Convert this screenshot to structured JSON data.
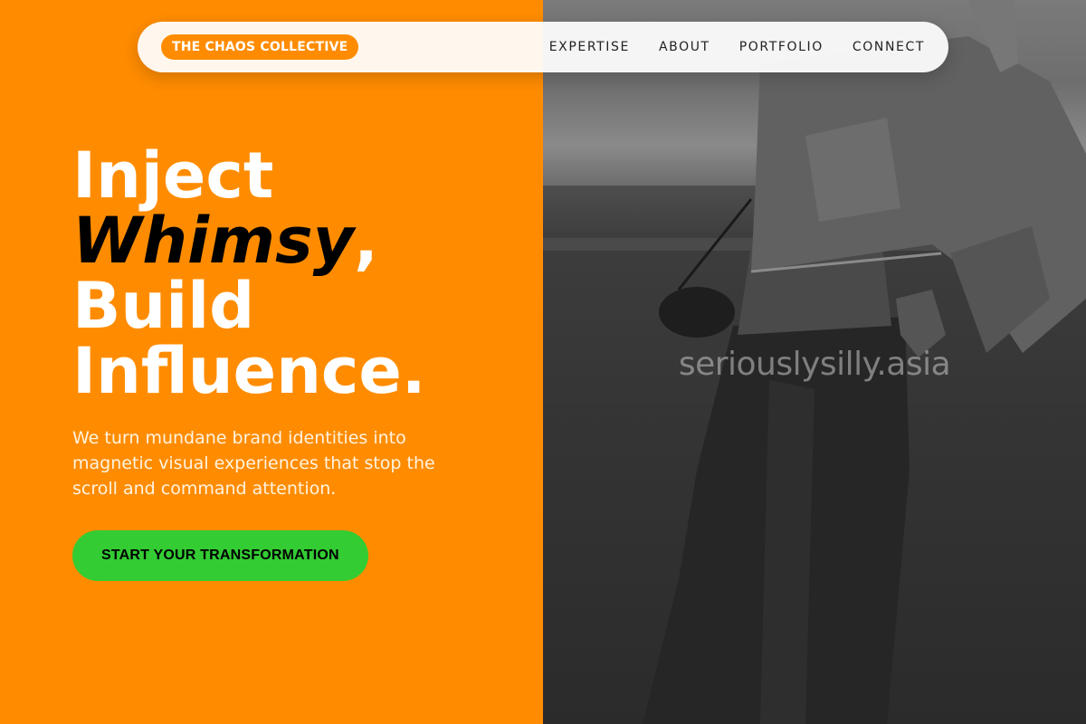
{
  "brand": {
    "name": "THE CHAOS COLLECTIVE"
  },
  "nav": {
    "items": [
      {
        "label": "EXPERTISE"
      },
      {
        "label": "ABOUT"
      },
      {
        "label": "PORTFOLIO"
      },
      {
        "label": "CONNECT"
      }
    ]
  },
  "hero": {
    "line1": "Inject",
    "accent_word": "Whimsy",
    "accent_punct": ",",
    "line3": "Build",
    "line4": "Influence.",
    "subtitle": "We turn mundane brand identities into magnetic visual experiences that stop the scroll and command attention.",
    "cta_label": "START YOUR TRANSFORMATION"
  },
  "photo": {
    "watermark": "seriouslysilly.asia"
  },
  "colors": {
    "accent_orange": "#ff8c00",
    "cta_green": "#33cc33",
    "text_white": "#ffffff",
    "text_black": "#000000"
  }
}
